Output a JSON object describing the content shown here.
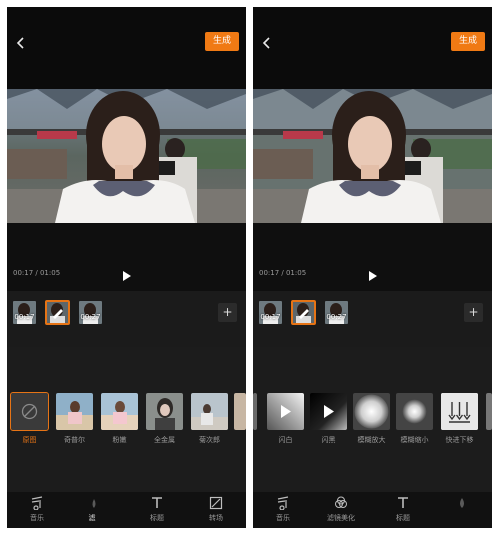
{
  "screens": [
    {
      "generate_label": "生成",
      "time": "00:17 / 01:05",
      "clips": [
        "00:17",
        "",
        "00:27"
      ],
      "items": [
        {
          "label": "原图",
          "active": true
        },
        {
          "label": "奇普尔"
        },
        {
          "label": "粉嫩"
        },
        {
          "label": "全金属"
        },
        {
          "label": "菊次郎"
        }
      ],
      "nav": [
        "音乐",
        "滤",
        "标题",
        "转场"
      ]
    },
    {
      "generate_label": "生成",
      "time": "00:17 / 01:05",
      "clips": [
        "00:17",
        "",
        "00:27"
      ],
      "items": [
        {
          "label": "闪白"
        },
        {
          "label": "闪黑"
        },
        {
          "label": "模糊放大"
        },
        {
          "label": "模糊缩小"
        },
        {
          "label": "快进下移"
        }
      ],
      "nav": [
        "音乐",
        "滤镜美化",
        "标题",
        ""
      ]
    }
  ]
}
